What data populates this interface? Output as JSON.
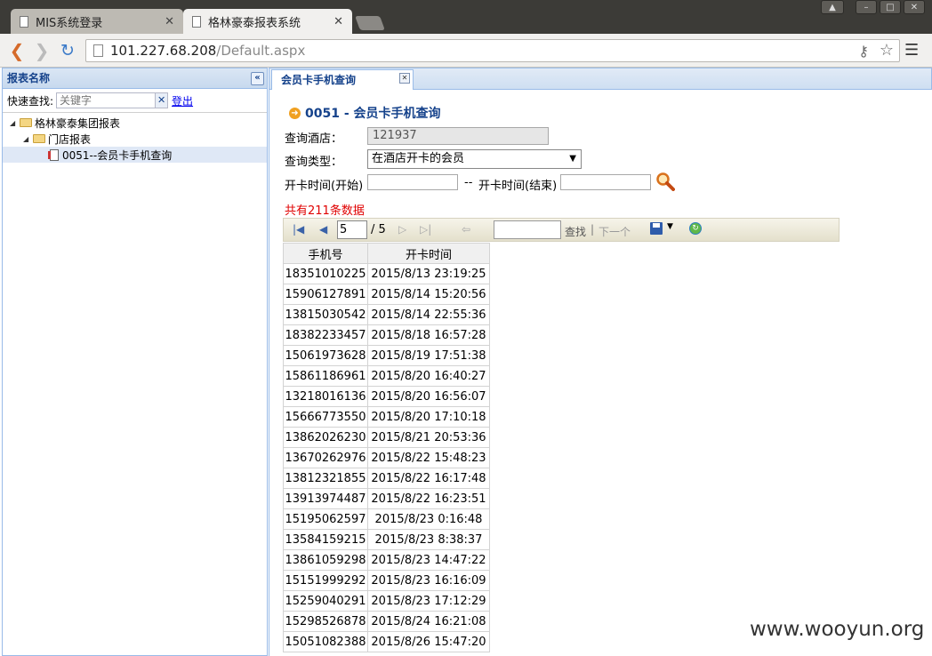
{
  "browser": {
    "tabs": [
      {
        "title": "MIS系统登录",
        "active": false
      },
      {
        "title": "格林豪泰报表系统",
        "active": true
      }
    ],
    "url_host": "101.227.68.208",
    "url_path": "/Default.aspx"
  },
  "sidebar": {
    "header": "报表名称",
    "search_label": "快速查找:",
    "search_placeholder": "关键字",
    "logout": "登出",
    "tree": [
      {
        "label": "格林豪泰集团报表",
        "level": 0
      },
      {
        "label": "门店报表",
        "level": 1
      },
      {
        "label": "0051--会员卡手机查询",
        "level": 2
      }
    ]
  },
  "main": {
    "tab_label": "会员卡手机查询",
    "report_title": "0051 - 会员卡手机查询",
    "form": {
      "hotel_label": "查询酒店：",
      "hotel_value": "121937",
      "type_label": "查询类型：",
      "type_value": "在酒店开卡的会员",
      "start_label": "开卡时间(开始)",
      "dash": "--",
      "end_label": "开卡时间(结束)"
    },
    "total_text": "共有211条数据",
    "pager": {
      "current_page": "5",
      "total_pages": "/ 5",
      "find_label": "查找",
      "separator": "|",
      "next_label": "下一个"
    },
    "table": {
      "headers": [
        "手机号",
        "开卡时间"
      ],
      "rows": [
        [
          "18351010225",
          "2015/8/13 23:19:25"
        ],
        [
          "15906127891",
          "2015/8/14 15:20:56"
        ],
        [
          "13815030542",
          "2015/8/14 22:55:36"
        ],
        [
          "18382233457",
          "2015/8/18 16:57:28"
        ],
        [
          "15061973628",
          "2015/8/19 17:51:38"
        ],
        [
          "15861186961",
          "2015/8/20 16:40:27"
        ],
        [
          "13218016136",
          "2015/8/20 16:56:07"
        ],
        [
          "15666773550",
          "2015/8/20 17:10:18"
        ],
        [
          "13862026230",
          "2015/8/21 20:53:36"
        ],
        [
          "13670262976",
          "2015/8/22 15:48:23"
        ],
        [
          "13812321855",
          "2015/8/22 16:17:48"
        ],
        [
          "13913974487",
          "2015/8/22 16:23:51"
        ],
        [
          "15195062597",
          "2015/8/23 0:16:48"
        ],
        [
          "13584159215",
          "2015/8/23 8:38:37"
        ],
        [
          "13861059298",
          "2015/8/23 14:47:22"
        ],
        [
          "15151999292",
          "2015/8/23 16:16:09"
        ],
        [
          "15259040291",
          "2015/8/23 17:12:29"
        ],
        [
          "15298526878",
          "2015/8/24 16:21:08"
        ],
        [
          "15051082388",
          "2015/8/26 15:47:20"
        ]
      ]
    }
  },
  "watermark": "www.wooyun.org",
  "colors": {
    "accent": "#15428b",
    "alert": "#e00000",
    "panel_border": "#99bbe8"
  }
}
